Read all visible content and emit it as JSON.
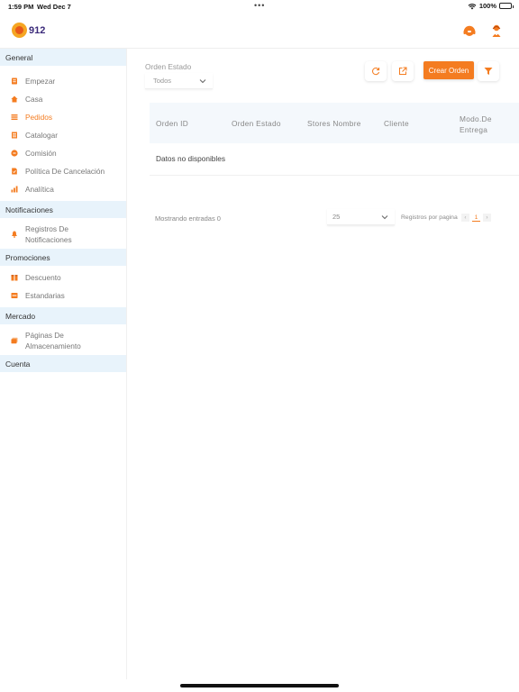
{
  "status_bar": {
    "time": "1:59 PM",
    "date": "Wed Dec 7",
    "dots": "•••",
    "battery": "100%"
  },
  "brand": {
    "logo_text": "912",
    "accent": "#f47c20"
  },
  "top_icons": [
    "support-icon",
    "user-icon"
  ],
  "sidebar": {
    "sections": [
      {
        "title": "General",
        "items": [
          {
            "label": "Empezar",
            "icon": "start-icon"
          },
          {
            "label": "Casa",
            "icon": "home-icon"
          },
          {
            "label": "Pedidos",
            "icon": "orders-icon",
            "active": true
          },
          {
            "label": "Catalogar",
            "icon": "catalog-icon"
          },
          {
            "label": "Comisión",
            "icon": "commission-icon"
          },
          {
            "label": "Política De Cancelación",
            "icon": "policy-icon"
          },
          {
            "label": "Analítica",
            "icon": "analytics-icon"
          }
        ]
      },
      {
        "title": "Notificaciones",
        "items": [
          {
            "label": "Registros De Notificaciones",
            "icon": "notification-icon"
          }
        ]
      },
      {
        "title": "Promociones",
        "items": [
          {
            "label": "Descuento",
            "icon": "discount-icon"
          },
          {
            "label": "Estandarias",
            "icon": "banner-icon"
          }
        ]
      },
      {
        "title": "Mercado",
        "items": [
          {
            "label": "Páginas De Almacenamiento",
            "icon": "store-pages-icon"
          }
        ]
      },
      {
        "title": "Cuenta",
        "items": []
      }
    ]
  },
  "filter": {
    "label": "Orden Estado",
    "value": "Todos"
  },
  "toolbar": {
    "create_label": "Crear Orden"
  },
  "table": {
    "columns": [
      "Orden ID",
      "Orden Estado",
      "Stores Nombre",
      "Cliente",
      "Modo.De Entrega"
    ],
    "empty_text": "Datos no disponibles"
  },
  "pagination": {
    "info": "Mostrando entradas 0",
    "page_size": "25",
    "rows_label": "Registros por pagina",
    "prev": "‹",
    "current": "1",
    "next": "›"
  }
}
